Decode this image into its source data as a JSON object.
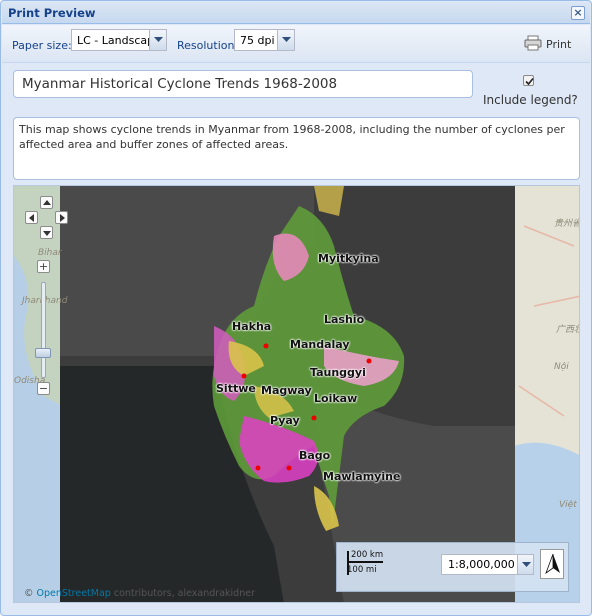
{
  "window": {
    "title": "Print Preview"
  },
  "toolbar": {
    "paper_size_label": "Paper size:",
    "paper_size_value": "LC -  Landscape",
    "resolution_label": "Resolution:",
    "resolution_value": "75 dpi",
    "print_label": "Print"
  },
  "form": {
    "title_value": "Myanmar Historical Cyclone Trends 1968-2008",
    "include_legend_label": "Include legend?",
    "include_legend_checked": true,
    "description_value": "This map shows cyclone trends in Myanmar from 1968-2008, including the number of cyclones per affected area and buffer zones of affected areas."
  },
  "map": {
    "cities": [
      "Myitkyina",
      "Lashio",
      "Hakha",
      "Mandalay",
      "Taunggyi",
      "Sittwe",
      "Magway",
      "Loikaw",
      "Pyay",
      "Bago",
      "Mawlamyine"
    ],
    "background_labels": [
      "Bihar",
      "Jharkhand",
      "Odisha",
      "贵州省",
      "广西壮族",
      "Nội",
      "Việt"
    ],
    "scale_top": "200 km",
    "scale_bottom": "100 mi",
    "scale_value": "1:8,000,000",
    "attribution_prefix": "©",
    "attribution_link": "OpenStreetMap",
    "attribution_rest": "contributors, alexandrakidner",
    "colors": {
      "satellite": "#3a3a3a",
      "land_green": "#5ea33a",
      "highlight_magenta": "#e040c8",
      "highlight_yellow": "#d9c34a",
      "pink": "#e8a0c8"
    }
  }
}
